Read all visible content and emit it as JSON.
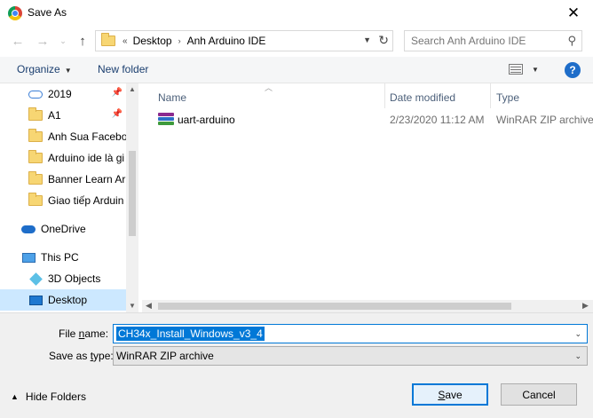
{
  "window": {
    "title": "Save As",
    "app_icon": "chrome-icon",
    "close_glyph": "✕"
  },
  "nav": {
    "back_glyph": "←",
    "forward_glyph": "→",
    "recent_glyph": "⌄",
    "up_glyph": "↑",
    "address": {
      "overflow": "«",
      "crumbs": [
        "Desktop",
        "Anh Arduino IDE"
      ],
      "arrow": "›"
    },
    "refresh_glyph": "↻",
    "search_placeholder": "Search Anh Arduino IDE"
  },
  "toolbar": {
    "organize": "Organize",
    "new_folder": "New folder",
    "help_glyph": "?"
  },
  "sidebar": {
    "items": [
      {
        "label": "2019",
        "icon": "onedrive-folder-icon",
        "pinned": true
      },
      {
        "label": "A1",
        "icon": "folder-icon",
        "pinned": true
      },
      {
        "label": "Anh Sua Facebo",
        "icon": "folder-icon",
        "pinned": false
      },
      {
        "label": "Arduino ide là gi",
        "icon": "folder-icon",
        "pinned": false
      },
      {
        "label": "Banner Learn Ar",
        "icon": "folder-icon",
        "pinned": false
      },
      {
        "label": "Giao tiếp Arduin",
        "icon": "folder-icon",
        "pinned": false
      },
      {
        "label": "OneDrive",
        "icon": "onedrive-icon",
        "pinned": false
      },
      {
        "label": "This PC",
        "icon": "this-pc-icon",
        "pinned": false
      },
      {
        "label": "3D Objects",
        "icon": "3d-objects-icon",
        "pinned": false
      },
      {
        "label": "Desktop",
        "icon": "desktop-icon",
        "pinned": false,
        "selected": true
      }
    ],
    "pin_glyph": "📌"
  },
  "files": {
    "columns": [
      "Name",
      "Date modified",
      "Type"
    ],
    "rows": [
      {
        "name": "uart-arduino",
        "date": "2/23/2020 11:12 AM",
        "type": "WinRAR ZIP archive",
        "icon": "winrar-archive-icon"
      }
    ]
  },
  "form": {
    "file_name_label_pre": "File ",
    "file_name_label_u": "n",
    "file_name_label_post": "ame:",
    "file_name_value": "CH34x_Install_Windows_v3_4",
    "save_type_label_pre": "Save as ",
    "save_type_label_u": "t",
    "save_type_label_post": "ype:",
    "save_type_value": "WinRAR ZIP archive"
  },
  "footer": {
    "hide_folders": "Hide Folders",
    "save_u": "S",
    "save_rest": "ave",
    "cancel": "Cancel"
  },
  "colors": {
    "accent": "#0078d7",
    "selection": "#cce8ff",
    "link": "#1a3e6f"
  }
}
